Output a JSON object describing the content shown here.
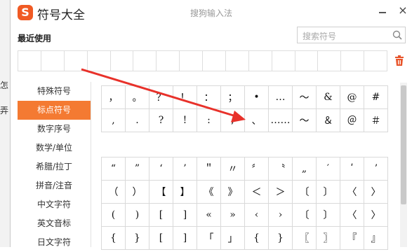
{
  "background_window": {
    "text_1": "怎",
    "text_2": "弄"
  },
  "window": {
    "logo": "S",
    "title": "符号大全",
    "subtitle": "搜狗输入法",
    "close_label": "×"
  },
  "recent": {
    "label": "最近使用"
  },
  "search": {
    "placeholder": "搜索符号"
  },
  "sidebar": {
    "items": [
      {
        "label": "特殊符号",
        "active": false
      },
      {
        "label": "标点符号",
        "active": true
      },
      {
        "label": "数字序号",
        "active": false
      },
      {
        "label": "数学/单位",
        "active": false
      },
      {
        "label": "希腊/拉丁",
        "active": false
      },
      {
        "label": "拼音/注音",
        "active": false
      },
      {
        "label": "中文字符",
        "active": false
      },
      {
        "label": "英文音标",
        "active": false
      },
      {
        "label": "日文字符",
        "active": false
      }
    ]
  },
  "grid1": [
    [
      "，",
      "。",
      "？",
      "！",
      "：",
      "；",
      "•",
      "…",
      "～",
      "&",
      "@",
      "#"
    ],
    [
      ",",
      ".",
      "?",
      "!",
      ":",
      ";",
      "、",
      "……",
      "〜",
      "＆",
      "＠",
      "＃"
    ]
  ],
  "grid2": [
    [
      "“",
      "”",
      "‘",
      "’",
      "＂",
      "〃",
      "〞",
      "〝",
      "„",
      "′",
      "ʹ",
      "ʼ"
    ],
    [
      "（",
      "）",
      "【",
      "】",
      "《",
      "》",
      "＜",
      "＞",
      "〔",
      "〕",
      "〈",
      "〉"
    ],
    [
      "(",
      ")",
      "[",
      "]",
      "«",
      "»",
      "‹",
      "›",
      "〔",
      "〕",
      "〈",
      "〉"
    ],
    [
      "{",
      "}",
      "[",
      "]",
      "「",
      "」",
      "{",
      "}",
      "〖",
      "〗",
      "『",
      "』"
    ]
  ],
  "colors": {
    "accent": "#f47a32",
    "arrow": "#e8312a",
    "trash": "#e8542a"
  }
}
